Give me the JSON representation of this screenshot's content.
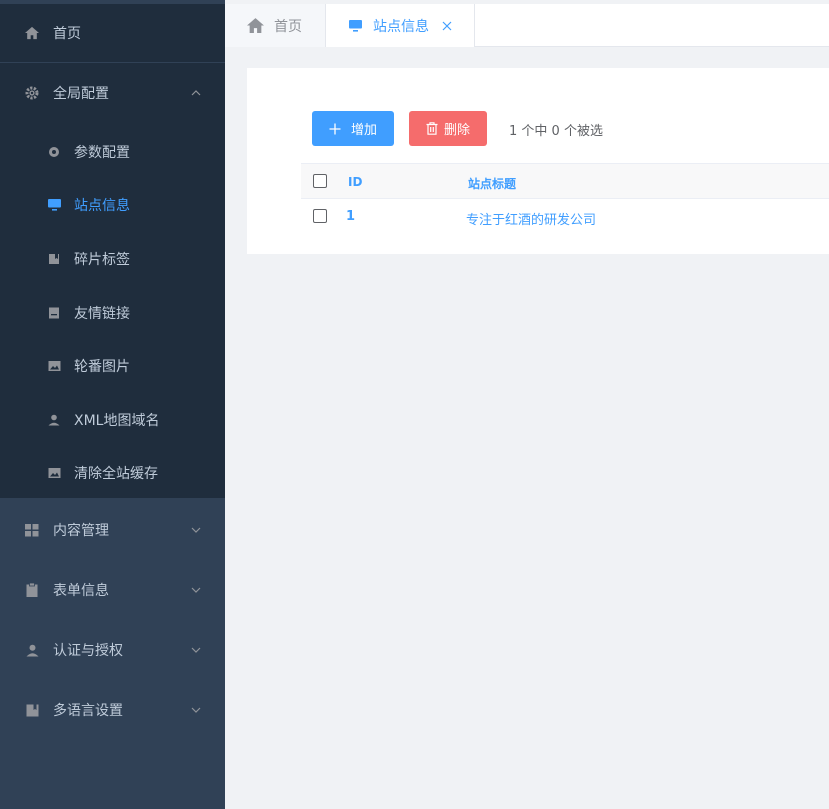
{
  "sidebar": {
    "home": {
      "label": "首页",
      "icon": "home-icon"
    },
    "global_config": {
      "label": "全局配置",
      "icon": "gear-icon",
      "expanded": true,
      "items": [
        {
          "label": "参数配置",
          "icon": "settings-circle-icon"
        },
        {
          "label": "站点信息",
          "icon": "monitor-icon",
          "active": true
        },
        {
          "label": "碎片标签",
          "icon": "book-icon"
        },
        {
          "label": "友情链接",
          "icon": "document-icon"
        },
        {
          "label": "轮番图片",
          "icon": "image-icon"
        },
        {
          "label": "XML地图域名",
          "icon": "user-icon"
        },
        {
          "label": "清除全站缓存",
          "icon": "image-icon"
        }
      ]
    },
    "groups": [
      {
        "label": "内容管理",
        "icon": "grid-icon"
      },
      {
        "label": "表单信息",
        "icon": "clipboard-icon"
      },
      {
        "label": "认证与授权",
        "icon": "user-icon"
      },
      {
        "label": "多语言设置",
        "icon": "book-icon"
      }
    ]
  },
  "tabs": [
    {
      "label": "首页",
      "icon": "home-icon"
    },
    {
      "label": "站点信息",
      "icon": "monitor-icon",
      "active": true,
      "closable": true
    }
  ],
  "toolbar": {
    "add_label": "增加",
    "delete_label": "删除",
    "selection_text": "1 个中 0 个被选"
  },
  "table": {
    "columns": [
      "ID",
      "站点标题"
    ],
    "rows": [
      {
        "id": "1",
        "title": "专注于红酒的研发公司"
      }
    ]
  },
  "colors": {
    "sidebar_bg": "#304156",
    "submenu_bg": "#1f2d3d",
    "accent": "#409eff",
    "danger": "#f56c6c"
  }
}
